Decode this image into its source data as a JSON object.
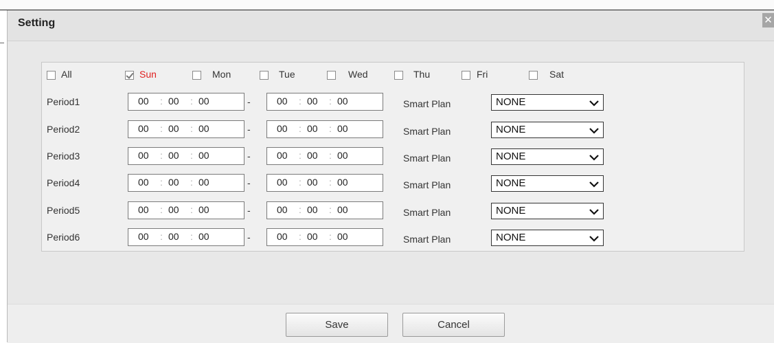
{
  "dialog": {
    "title": "Setting",
    "close_symbol": "✕"
  },
  "days": [
    {
      "label": "All",
      "checked": false
    },
    {
      "label": "Sun",
      "checked": true
    },
    {
      "label": "Mon",
      "checked": false
    },
    {
      "label": "Tue",
      "checked": false
    },
    {
      "label": "Wed",
      "checked": false
    },
    {
      "label": "Thu",
      "checked": false
    },
    {
      "label": "Fri",
      "checked": false
    },
    {
      "label": "Sat",
      "checked": false
    }
  ],
  "periods": [
    {
      "label": "Period1",
      "start": [
        "00",
        "00",
        "00"
      ],
      "end": [
        "00",
        "00",
        "00"
      ],
      "smart_plan_label": "Smart Plan",
      "smart_plan_value": "NONE"
    },
    {
      "label": "Period2",
      "start": [
        "00",
        "00",
        "00"
      ],
      "end": [
        "00",
        "00",
        "00"
      ],
      "smart_plan_label": "Smart Plan",
      "smart_plan_value": "NONE"
    },
    {
      "label": "Period3",
      "start": [
        "00",
        "00",
        "00"
      ],
      "end": [
        "00",
        "00",
        "00"
      ],
      "smart_plan_label": "Smart Plan",
      "smart_plan_value": "NONE"
    },
    {
      "label": "Period4",
      "start": [
        "00",
        "00",
        "00"
      ],
      "end": [
        "00",
        "00",
        "00"
      ],
      "smart_plan_label": "Smart Plan",
      "smart_plan_value": "NONE"
    },
    {
      "label": "Period5",
      "start": [
        "00",
        "00",
        "00"
      ],
      "end": [
        "00",
        "00",
        "00"
      ],
      "smart_plan_label": "Smart Plan",
      "smart_plan_value": "NONE"
    },
    {
      "label": "Period6",
      "start": [
        "00",
        "00",
        "00"
      ],
      "end": [
        "00",
        "00",
        "00"
      ],
      "smart_plan_label": "Smart Plan",
      "smart_plan_value": "NONE"
    }
  ],
  "separators": {
    "time": ":",
    "range": "-",
    "chevron": "❯"
  },
  "icons": {
    "close": "close-icon",
    "dropdown": "chevron-down-icon",
    "check": "checkmark-icon"
  },
  "colors": {
    "selected_day": "#e02020",
    "close_button": "#a6a6a6"
  },
  "footer": {
    "save_label": "Save",
    "cancel_label": "Cancel"
  }
}
